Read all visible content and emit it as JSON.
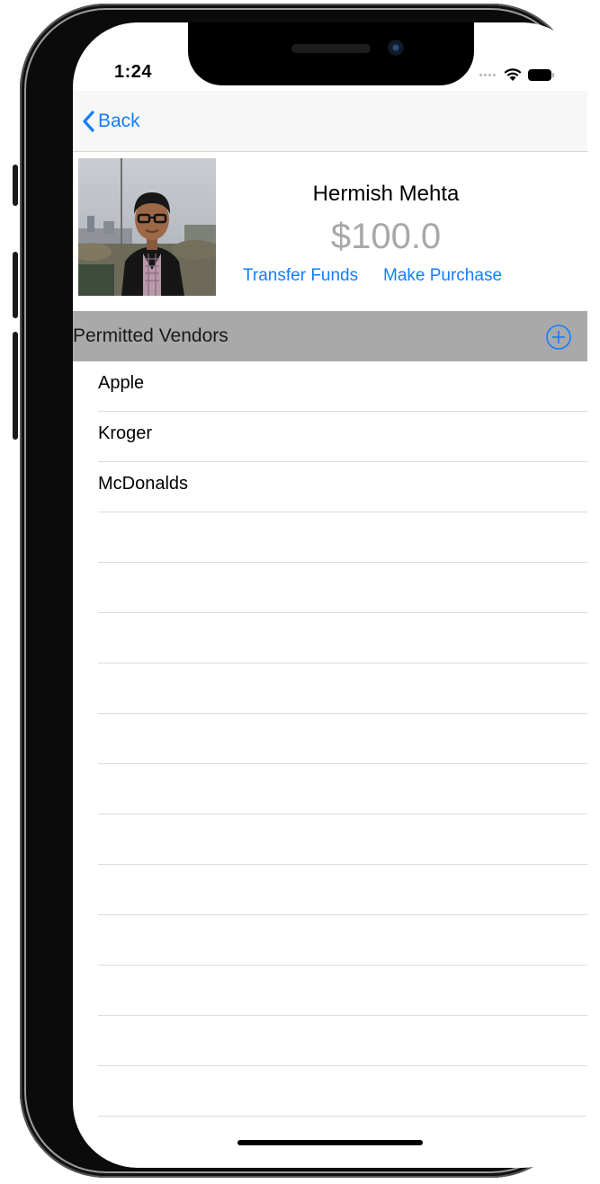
{
  "status_bar": {
    "time": "1:24"
  },
  "nav": {
    "back_label": "Back"
  },
  "profile": {
    "name": "Hermish Mehta",
    "balance": "$100.0",
    "transfer_label": "Transfer Funds",
    "purchase_label": "Make Purchase"
  },
  "section": {
    "title": "Permitted Vendors"
  },
  "vendors": [
    "Apple",
    "Kroger",
    "McDonalds"
  ],
  "colors": {
    "accent": "#147efb",
    "section_bg": "#a9a9a9",
    "balance_text": "#a8a8a8"
  },
  "icons": [
    "back-chevron-icon",
    "add-circle-icon",
    "wifi-icon",
    "battery-icon",
    "signal-dots-icon"
  ]
}
